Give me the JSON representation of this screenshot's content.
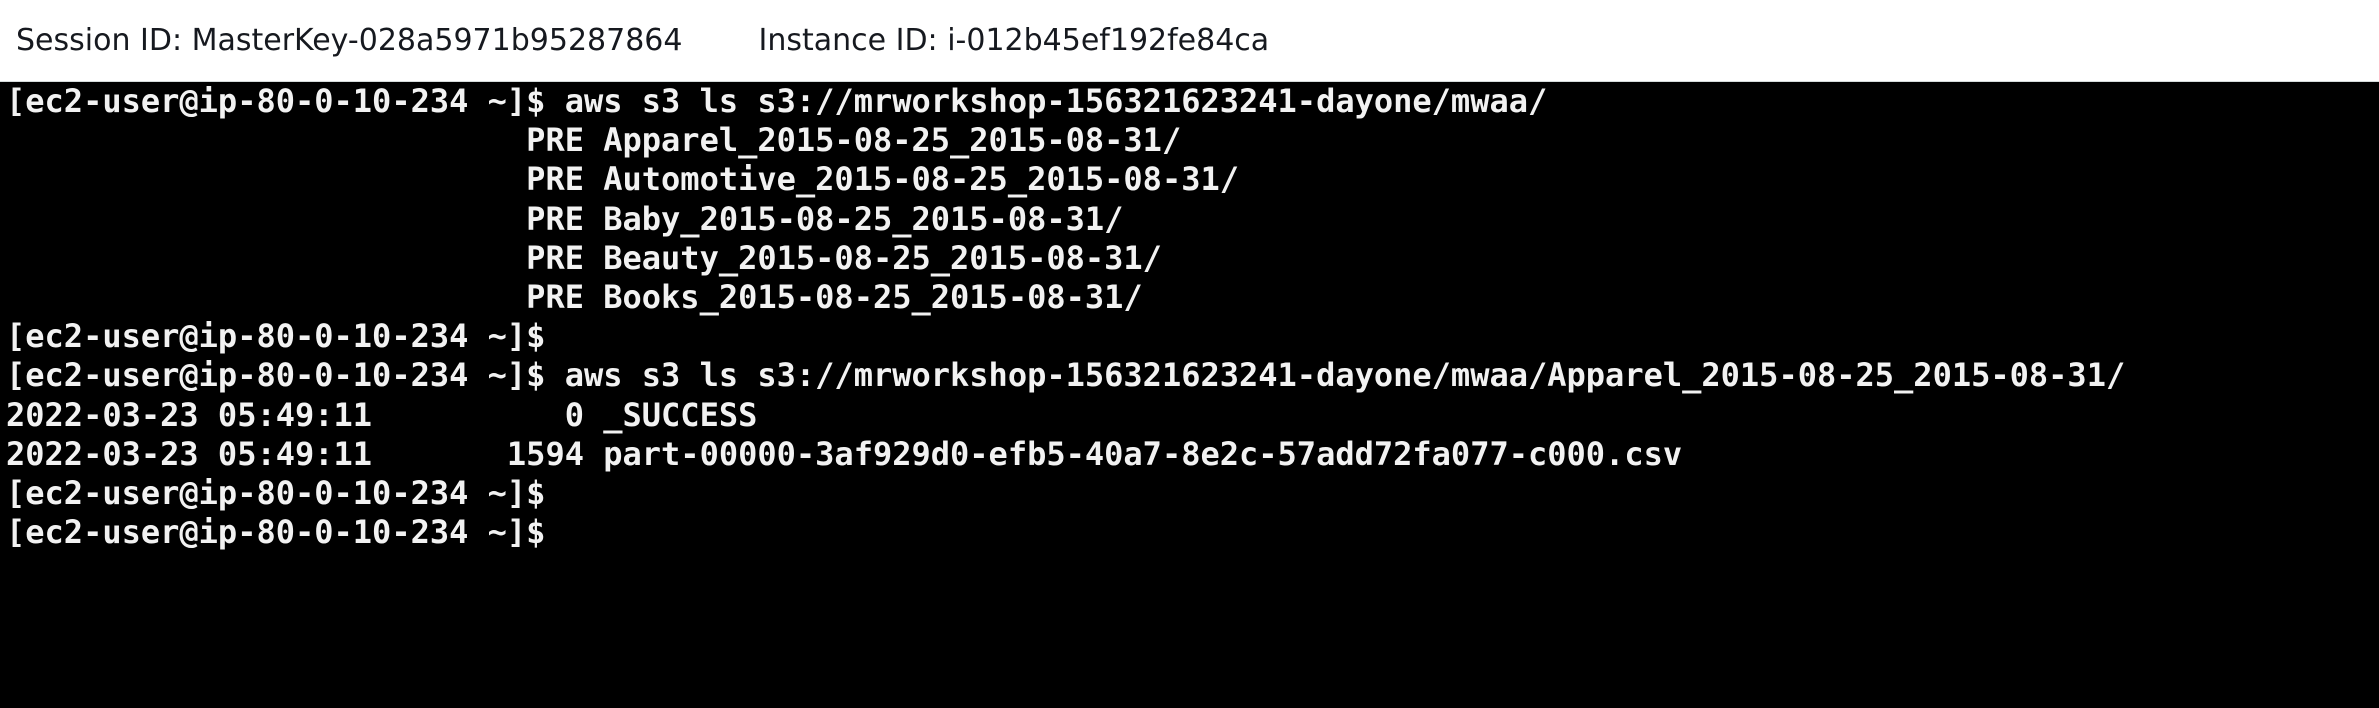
{
  "header": {
    "session_id": "Session ID: MasterKey-028a5971b95287864",
    "instance_id": "Instance ID: i-012b45ef192fe84ca"
  },
  "terminal": {
    "lines": [
      "[ec2-user@ip-80-0-10-234 ~]$ aws s3 ls s3://mrworkshop-156321623241-dayone/mwaa/",
      "                           PRE Apparel_2015-08-25_2015-08-31/",
      "                           PRE Automotive_2015-08-25_2015-08-31/",
      "                           PRE Baby_2015-08-25_2015-08-31/",
      "                           PRE Beauty_2015-08-25_2015-08-31/",
      "                           PRE Books_2015-08-25_2015-08-31/",
      "[ec2-user@ip-80-0-10-234 ~]$",
      "[ec2-user@ip-80-0-10-234 ~]$ aws s3 ls s3://mrworkshop-156321623241-dayone/mwaa/Apparel_2015-08-25_2015-08-31/",
      "2022-03-23 05:49:11          0 _SUCCESS",
      "2022-03-23 05:49:11       1594 part-00000-3af929d0-efb5-40a7-8e2c-57add72fa077-c000.csv",
      "[ec2-user@ip-80-0-10-234 ~]$",
      "[ec2-user@ip-80-0-10-234 ~]$"
    ]
  }
}
